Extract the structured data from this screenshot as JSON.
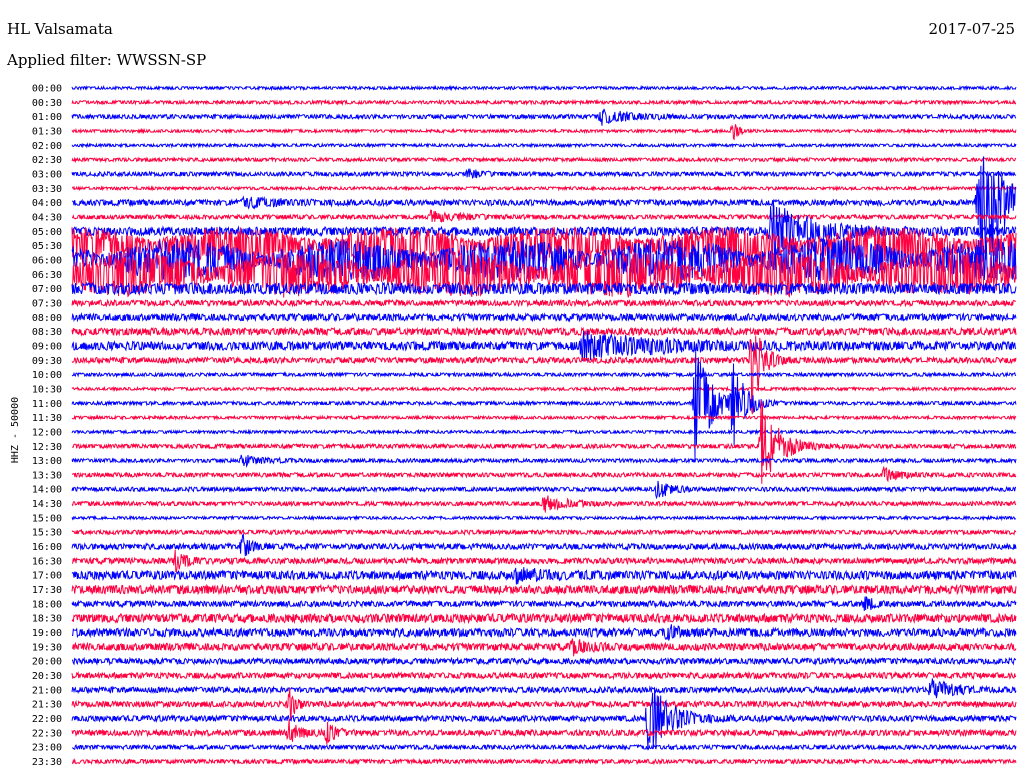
{
  "header": {
    "station": "HL Valsamata",
    "date": "2017-07-25",
    "filter": "Applied filter: WWSSN-SP"
  },
  "axis_label": "HHZ - 50000",
  "colors": {
    "blue": "#0000ff",
    "red": "#ff0040",
    "background": "#ffffff"
  },
  "chart_data": {
    "type": "line",
    "title": "HL Valsamata",
    "ylabel": "HHZ - 50000",
    "rows": [
      "00:00",
      "00:30",
      "01:00",
      "01:30",
      "02:00",
      "02:30",
      "03:00",
      "03:30",
      "04:00",
      "04:30",
      "05:00",
      "05:30",
      "06:00",
      "06:30",
      "07:00",
      "07:30",
      "08:00",
      "08:30",
      "09:00",
      "09:30",
      "10:00",
      "10:30",
      "11:00",
      "11:30",
      "12:00",
      "12:30",
      "13:00",
      "13:30",
      "14:00",
      "14:30",
      "15:00",
      "15:30",
      "16:00",
      "16:30",
      "17:00",
      "17:30",
      "18:00",
      "18:30",
      "19:00",
      "19:30",
      "20:00",
      "20:30",
      "21:00",
      "21:30",
      "22:00",
      "22:30",
      "23:00",
      "23:30"
    ],
    "noise": [
      1,
      1.2,
      1.5,
      1,
      1,
      1.2,
      1.5,
      1,
      2,
      1.5,
      3,
      8,
      9,
      10,
      4,
      2,
      2.5,
      2.5,
      3,
      2,
      1.2,
      1,
      1.2,
      1,
      1,
      1.5,
      1.3,
      1.5,
      1.5,
      1.5,
      1,
      1.5,
      2,
      2,
      3,
      3,
      2,
      3,
      3,
      2.5,
      2,
      2,
      2,
      2,
      2,
      2,
      1.5,
      1.5
    ],
    "events": [
      {
        "row": "01:00",
        "pos": 0.56,
        "amp": 8,
        "width": 30
      },
      {
        "row": "01:30",
        "pos": 0.7,
        "amp": 10,
        "width": 6
      },
      {
        "row": "03:00",
        "pos": 0.42,
        "amp": 5,
        "width": 12
      },
      {
        "row": "04:00",
        "pos": 0.18,
        "amp": 5,
        "width": 40
      },
      {
        "row": "04:00",
        "pos": 0.96,
        "amp": 95,
        "width": 22
      },
      {
        "row": "04:30",
        "pos": 0.38,
        "amp": 6,
        "width": 30
      },
      {
        "row": "05:00",
        "pos": 0.74,
        "amp": 30,
        "width": 40
      },
      {
        "row": "09:00",
        "pos": 0.54,
        "amp": 14,
        "width": 80
      },
      {
        "row": "09:30",
        "pos": 0.72,
        "amp": 55,
        "width": 10
      },
      {
        "row": "11:00",
        "pos": 0.66,
        "amp": 60,
        "width": 16
      },
      {
        "row": "11:00",
        "pos": 0.7,
        "amp": 45,
        "width": 12
      },
      {
        "row": "12:30",
        "pos": 0.73,
        "amp": 45,
        "width": 18
      },
      {
        "row": "13:00",
        "pos": 0.18,
        "amp": 7,
        "width": 20
      },
      {
        "row": "13:30",
        "pos": 0.86,
        "amp": 8,
        "width": 14
      },
      {
        "row": "14:00",
        "pos": 0.62,
        "amp": 10,
        "width": 14
      },
      {
        "row": "14:30",
        "pos": 0.5,
        "amp": 8,
        "width": 22
      },
      {
        "row": "16:00",
        "pos": 0.18,
        "amp": 12,
        "width": 10
      },
      {
        "row": "16:30",
        "pos": 0.11,
        "amp": 12,
        "width": 10
      },
      {
        "row": "17:00",
        "pos": 0.47,
        "amp": 7,
        "width": 30
      },
      {
        "row": "18:00",
        "pos": 0.84,
        "amp": 8,
        "width": 10
      },
      {
        "row": "19:00",
        "pos": 0.63,
        "amp": 8,
        "width": 12
      },
      {
        "row": "19:30",
        "pos": 0.53,
        "amp": 9,
        "width": 16
      },
      {
        "row": "21:00",
        "pos": 0.91,
        "amp": 12,
        "width": 20
      },
      {
        "row": "21:30",
        "pos": 0.23,
        "amp": 18,
        "width": 6
      },
      {
        "row": "22:00",
        "pos": 0.61,
        "amp": 40,
        "width": 22
      },
      {
        "row": "22:30",
        "pos": 0.23,
        "amp": 15,
        "width": 10
      },
      {
        "row": "22:30",
        "pos": 0.27,
        "amp": 12,
        "width": 10
      }
    ]
  }
}
